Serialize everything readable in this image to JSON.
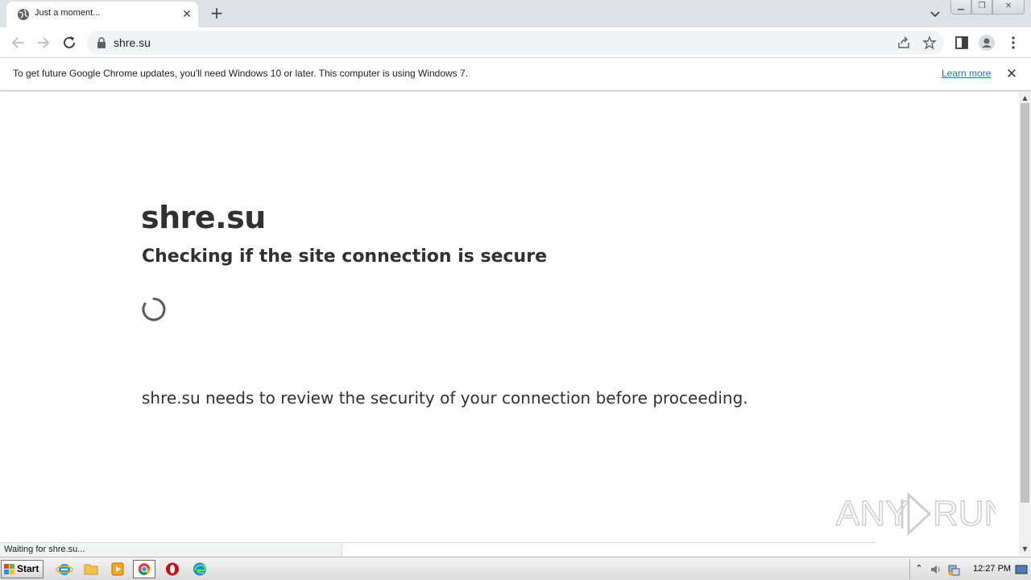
{
  "browser": {
    "tab": {
      "title": "Just a moment...",
      "favicon": "globe-icon"
    },
    "address": {
      "url": "shre.su"
    },
    "infobar": {
      "message": "To get future Google Chrome updates, you'll need Windows 10 or later. This computer is using Windows 7.",
      "link": "Learn more"
    },
    "status_text": "Waiting for shre.su..."
  },
  "page": {
    "site_name": "shre.su",
    "subtitle": "Checking if the site connection is secure",
    "review_message": "shre.su needs to review the security of your connection before proceeding."
  },
  "watermark": {
    "text": "ANY RUN"
  },
  "taskbar": {
    "start_label": "Start",
    "clock": "12:27 PM",
    "apps": [
      "internet-explorer-icon",
      "folder-icon",
      "media-player-icon",
      "chrome-icon",
      "opera-icon",
      "edge-icon"
    ]
  },
  "colors": {
    "link": "#1a73e8",
    "text": "#313131",
    "tab_strip": "#dee1e6"
  }
}
